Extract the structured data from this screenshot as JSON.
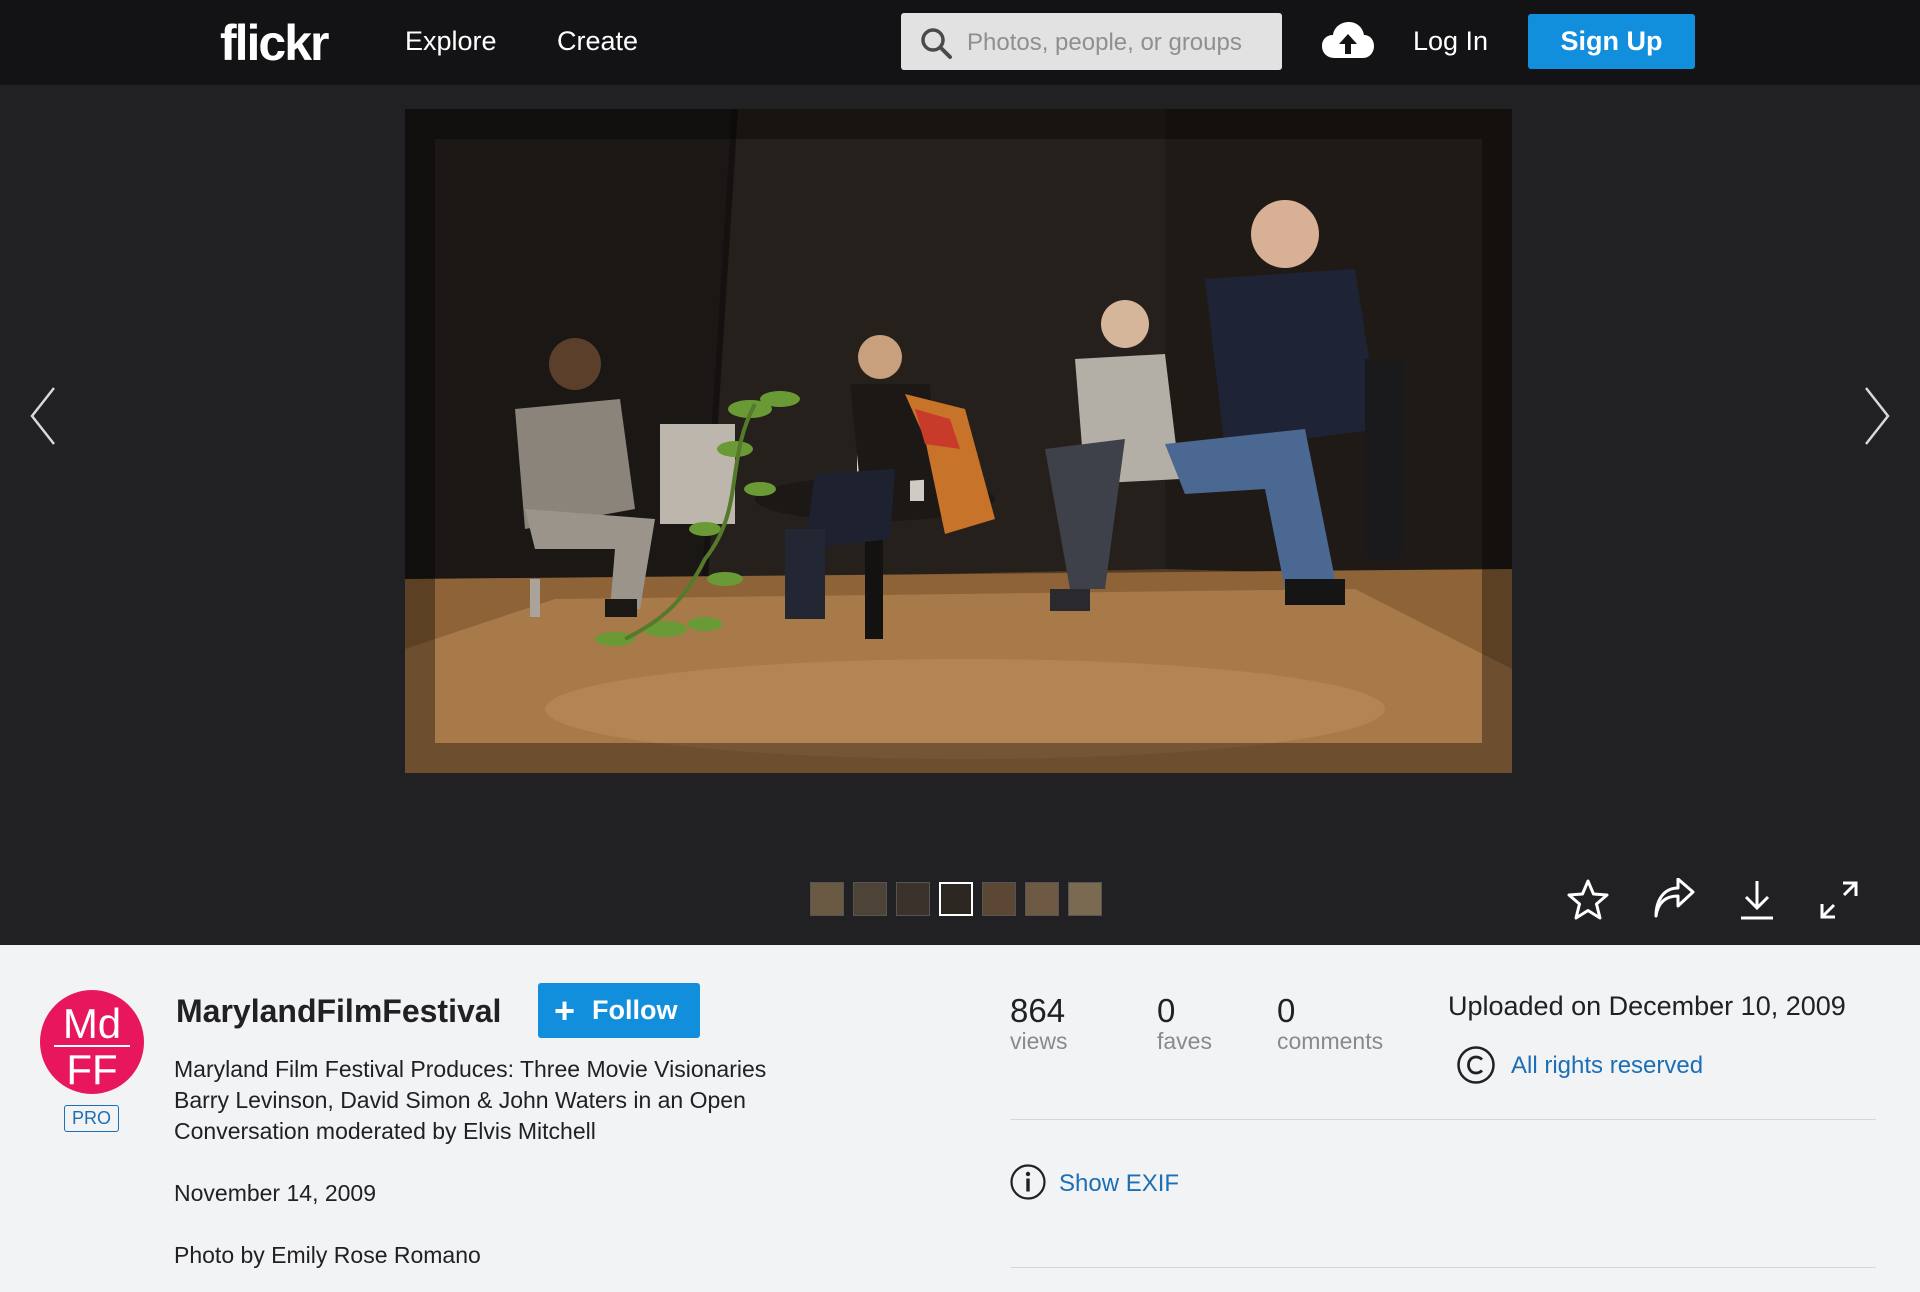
{
  "nav": {
    "logo": "flickr",
    "explore": "Explore",
    "create": "Create",
    "search_placeholder": "Photos, people, or groups",
    "login": "Log In",
    "signup": "Sign Up"
  },
  "icons": {
    "search": "search-icon",
    "upload": "cloud-upload-icon",
    "prev": "chevron-left-icon",
    "next": "chevron-right-icon",
    "fave": "star-icon",
    "share": "share-icon",
    "download": "download-icon",
    "fullscreen": "expand-icon",
    "copyright": "copyright-icon",
    "info": "info-icon"
  },
  "colors": {
    "accent": "#128fdc",
    "link": "#1c6fb5",
    "avatar": "#e8175d",
    "navbar": "#131315",
    "stage": "#212124",
    "panel": "#f2f3f4"
  },
  "photo": {
    "filmstrip_count": 7
  },
  "owner": {
    "avatar_text_top": "Md",
    "avatar_text_bottom": "FF",
    "badge": "PRO",
    "name": "MarylandFilmFestival",
    "follow": "Follow"
  },
  "description": {
    "line1": "Maryland Film Festival Produces: Three Movie Visionaries",
    "line2": "Barry Levinson, David Simon & John Waters in an Open",
    "line3": "Conversation moderated by Elvis Mitchell",
    "date": "November 14, 2009",
    "credit": "Photo by Emily Rose Romano"
  },
  "stats": {
    "views_count": "864",
    "views_label": "views",
    "faves_count": "0",
    "faves_label": "faves",
    "comments_count": "0",
    "comments_label": "comments"
  },
  "meta": {
    "uploaded": "Uploaded on December 10, 2009",
    "rights": "All rights reserved",
    "exif": "Show EXIF"
  }
}
